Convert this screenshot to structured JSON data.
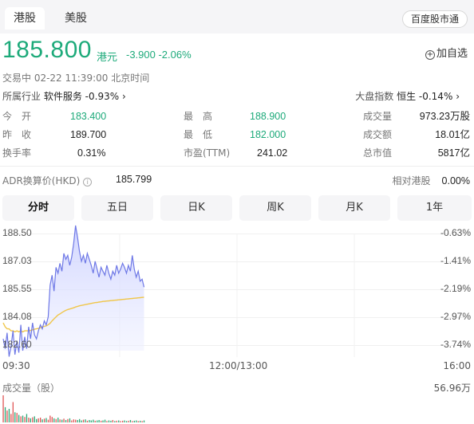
{
  "tabs": [
    {
      "label": "港股"
    },
    {
      "label": "美股"
    }
  ],
  "market_button": "百度股市通",
  "quote": {
    "price": "185.800",
    "currency": "港元",
    "change": "-3.900 -2.06%",
    "add_watch": "加自选"
  },
  "status": "交易中  02-22 11:39:00 北京时间",
  "industry": {
    "label": "所属行业",
    "value": "软件服务 -0.93%",
    "arrow": "›"
  },
  "index": {
    "label": "大盘指数",
    "value": "恒生 -0.14%",
    "arrow": "›"
  },
  "stats": [
    {
      "label": "今　开",
      "value": "183.400",
      "color": "#1daa7a"
    },
    {
      "label": "昨　收",
      "value": "189.700",
      "color": "#222222"
    },
    {
      "label": "换手率",
      "value": "0.31%",
      "color": "#222222"
    },
    {
      "label": "最　高",
      "value": "188.900",
      "color": "#1daa7a"
    },
    {
      "label": "最　低",
      "value": "182.000",
      "color": "#1daa7a"
    },
    {
      "label": "市盈(TTM)",
      "value": "241.02",
      "color": "#222222"
    },
    {
      "label": "成交量",
      "value": "973.23万股",
      "color": "#222222"
    },
    {
      "label": "成交额",
      "value": "18.01亿",
      "color": "#222222"
    },
    {
      "label": "总市值",
      "value": "5817亿",
      "color": "#222222"
    }
  ],
  "adr": {
    "label": "ADR换算价(HKD)",
    "info_icon": "i",
    "value": "185.799",
    "rel_label": "相对港股",
    "rel_value": "0.00%"
  },
  "period_tabs": [
    {
      "label": "分时"
    },
    {
      "label": "五日"
    },
    {
      "label": "日K"
    },
    {
      "label": "周K"
    },
    {
      "label": "月K"
    },
    {
      "label": "1年"
    }
  ],
  "chart_labels": {
    "left_ticks": [
      "188.50",
      "187.03",
      "185.55",
      "184.08",
      "182.60"
    ],
    "right_ticks": [
      "-0.63%",
      "-1.41%",
      "-2.19%",
      "-2.97%",
      "-3.74%"
    ],
    "time_ticks": [
      "09:30",
      "12:00/13:00",
      "16:00"
    ],
    "volume_label": "成交量（股）",
    "volume_max": "56.96万"
  },
  "chart_data": {
    "type": "line",
    "x_range": [
      "09:30",
      "16:00"
    ],
    "ylim": [
      182.6,
      188.5
    ],
    "series": [
      {
        "values": [
          183.2,
          182.7,
          183.5,
          182.3,
          182.8,
          183.6,
          182.4,
          183.1,
          182.5,
          183.9,
          182.6,
          183.3,
          182.7,
          183.8,
          183.2,
          184.0,
          183.4,
          183.2,
          183.6,
          183.9,
          183.7,
          184.1,
          183.9,
          184.3,
          185.9,
          186.4,
          185.6,
          186.8,
          186.5,
          187.0,
          186.6,
          187.5,
          187.2,
          187.4,
          186.9,
          187.3,
          188.0,
          188.9,
          188.3,
          187.6,
          187.1,
          187.4,
          187.0,
          187.5,
          187.2,
          186.9,
          186.5,
          187.1,
          186.7,
          186.3,
          186.8,
          186.6,
          186.4,
          186.9,
          186.5,
          186.2,
          186.6,
          186.4,
          186.9,
          186.5,
          186.7,
          187.0,
          186.8,
          186.5,
          186.9,
          186.6,
          187.4,
          186.7,
          186.3,
          186.6,
          186.1,
          186.2,
          185.8
        ]
      },
      {
        "values": [
          184.0,
          183.8,
          183.7,
          183.7,
          183.6,
          183.6,
          183.55,
          183.6,
          183.55,
          183.6,
          183.55,
          183.6,
          183.6,
          183.6,
          183.62,
          183.65,
          183.68,
          183.7,
          183.72,
          183.75,
          183.8,
          183.82,
          183.85,
          183.9,
          183.98,
          184.1,
          184.2,
          184.3,
          184.4,
          184.45,
          184.52,
          184.58,
          184.63,
          184.67,
          184.7,
          184.73,
          184.76,
          184.8,
          184.83,
          184.86,
          184.88,
          184.9,
          184.92,
          184.94,
          184.96,
          184.98,
          185.0,
          185.02,
          185.03,
          185.05,
          185.06,
          185.08,
          185.09,
          185.1,
          185.11,
          185.12,
          185.13,
          185.14,
          185.15,
          185.16,
          185.17,
          185.18,
          185.19,
          185.2,
          185.21,
          185.22,
          185.23,
          185.24,
          185.25,
          185.26,
          185.27,
          185.28,
          185.29
        ]
      }
    ],
    "volume_series": [
      80,
      45,
      35,
      40,
      25,
      60,
      30,
      28,
      22,
      18,
      20,
      16,
      25,
      14,
      12,
      15,
      18,
      10,
      12,
      14,
      9,
      11,
      13,
      8,
      20,
      16,
      12,
      10,
      14,
      9,
      8,
      11,
      7,
      10,
      12,
      6,
      9,
      8,
      7,
      10,
      6,
      8,
      9,
      5,
      7,
      6,
      8,
      5,
      6,
      7,
      5,
      6,
      8,
      4,
      6,
      5,
      7,
      4,
      5,
      6,
      4,
      5,
      6,
      4,
      5,
      7,
      4,
      5,
      6,
      4,
      5,
      4,
      6
    ],
    "colors": {
      "price": "#6e78e6",
      "avg": "#f0c64a",
      "fill": "#dcdfff",
      "vol_up": "#e05555",
      "vol_down": "#2aa876"
    }
  }
}
